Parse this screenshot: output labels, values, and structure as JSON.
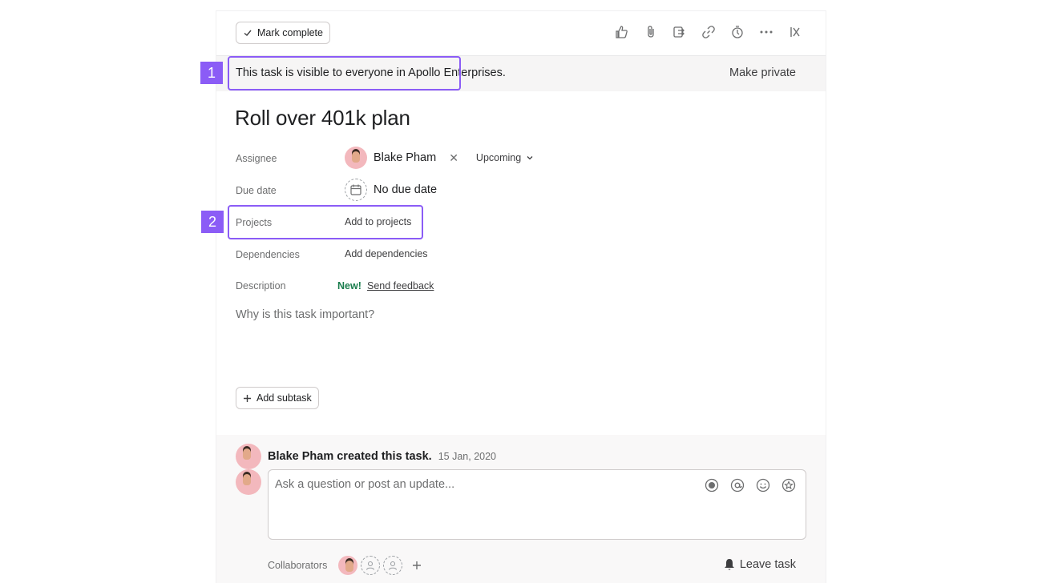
{
  "toolbar": {
    "mark_complete": "Mark complete",
    "icons": [
      "like-icon",
      "attachment-icon",
      "subtask-icon",
      "copy-link-icon",
      "timer-icon",
      "more-icon",
      "close-icon"
    ]
  },
  "visibility": {
    "text": "This task is visible to everyone in Apollo Enterprises.",
    "make_private": "Make private"
  },
  "task": {
    "title": "Roll over 401k plan"
  },
  "fields": {
    "assignee_label": "Assignee",
    "assignee_name": "Blake Pham",
    "upcoming": "Upcoming",
    "due_label": "Due date",
    "due_value": "No due date",
    "projects_label": "Projects",
    "add_projects": "Add to projects",
    "dependencies_label": "Dependencies",
    "add_dependencies": "Add dependencies",
    "description_label": "Description",
    "new_badge": "New!",
    "send_feedback": "Send feedback",
    "description_placeholder": "Why is this task important?"
  },
  "subtask": {
    "label": "Add subtask"
  },
  "activity": {
    "text": "Blake Pham created this task.",
    "date": "15 Jan, 2020"
  },
  "comment": {
    "placeholder": "Ask a question or post an update..."
  },
  "collaborators": {
    "label": "Collaborators",
    "leave": "Leave task"
  },
  "callouts": [
    "1",
    "2"
  ],
  "colors": {
    "accent": "#8b5cf6",
    "new_badge": "#1a7d4d"
  }
}
